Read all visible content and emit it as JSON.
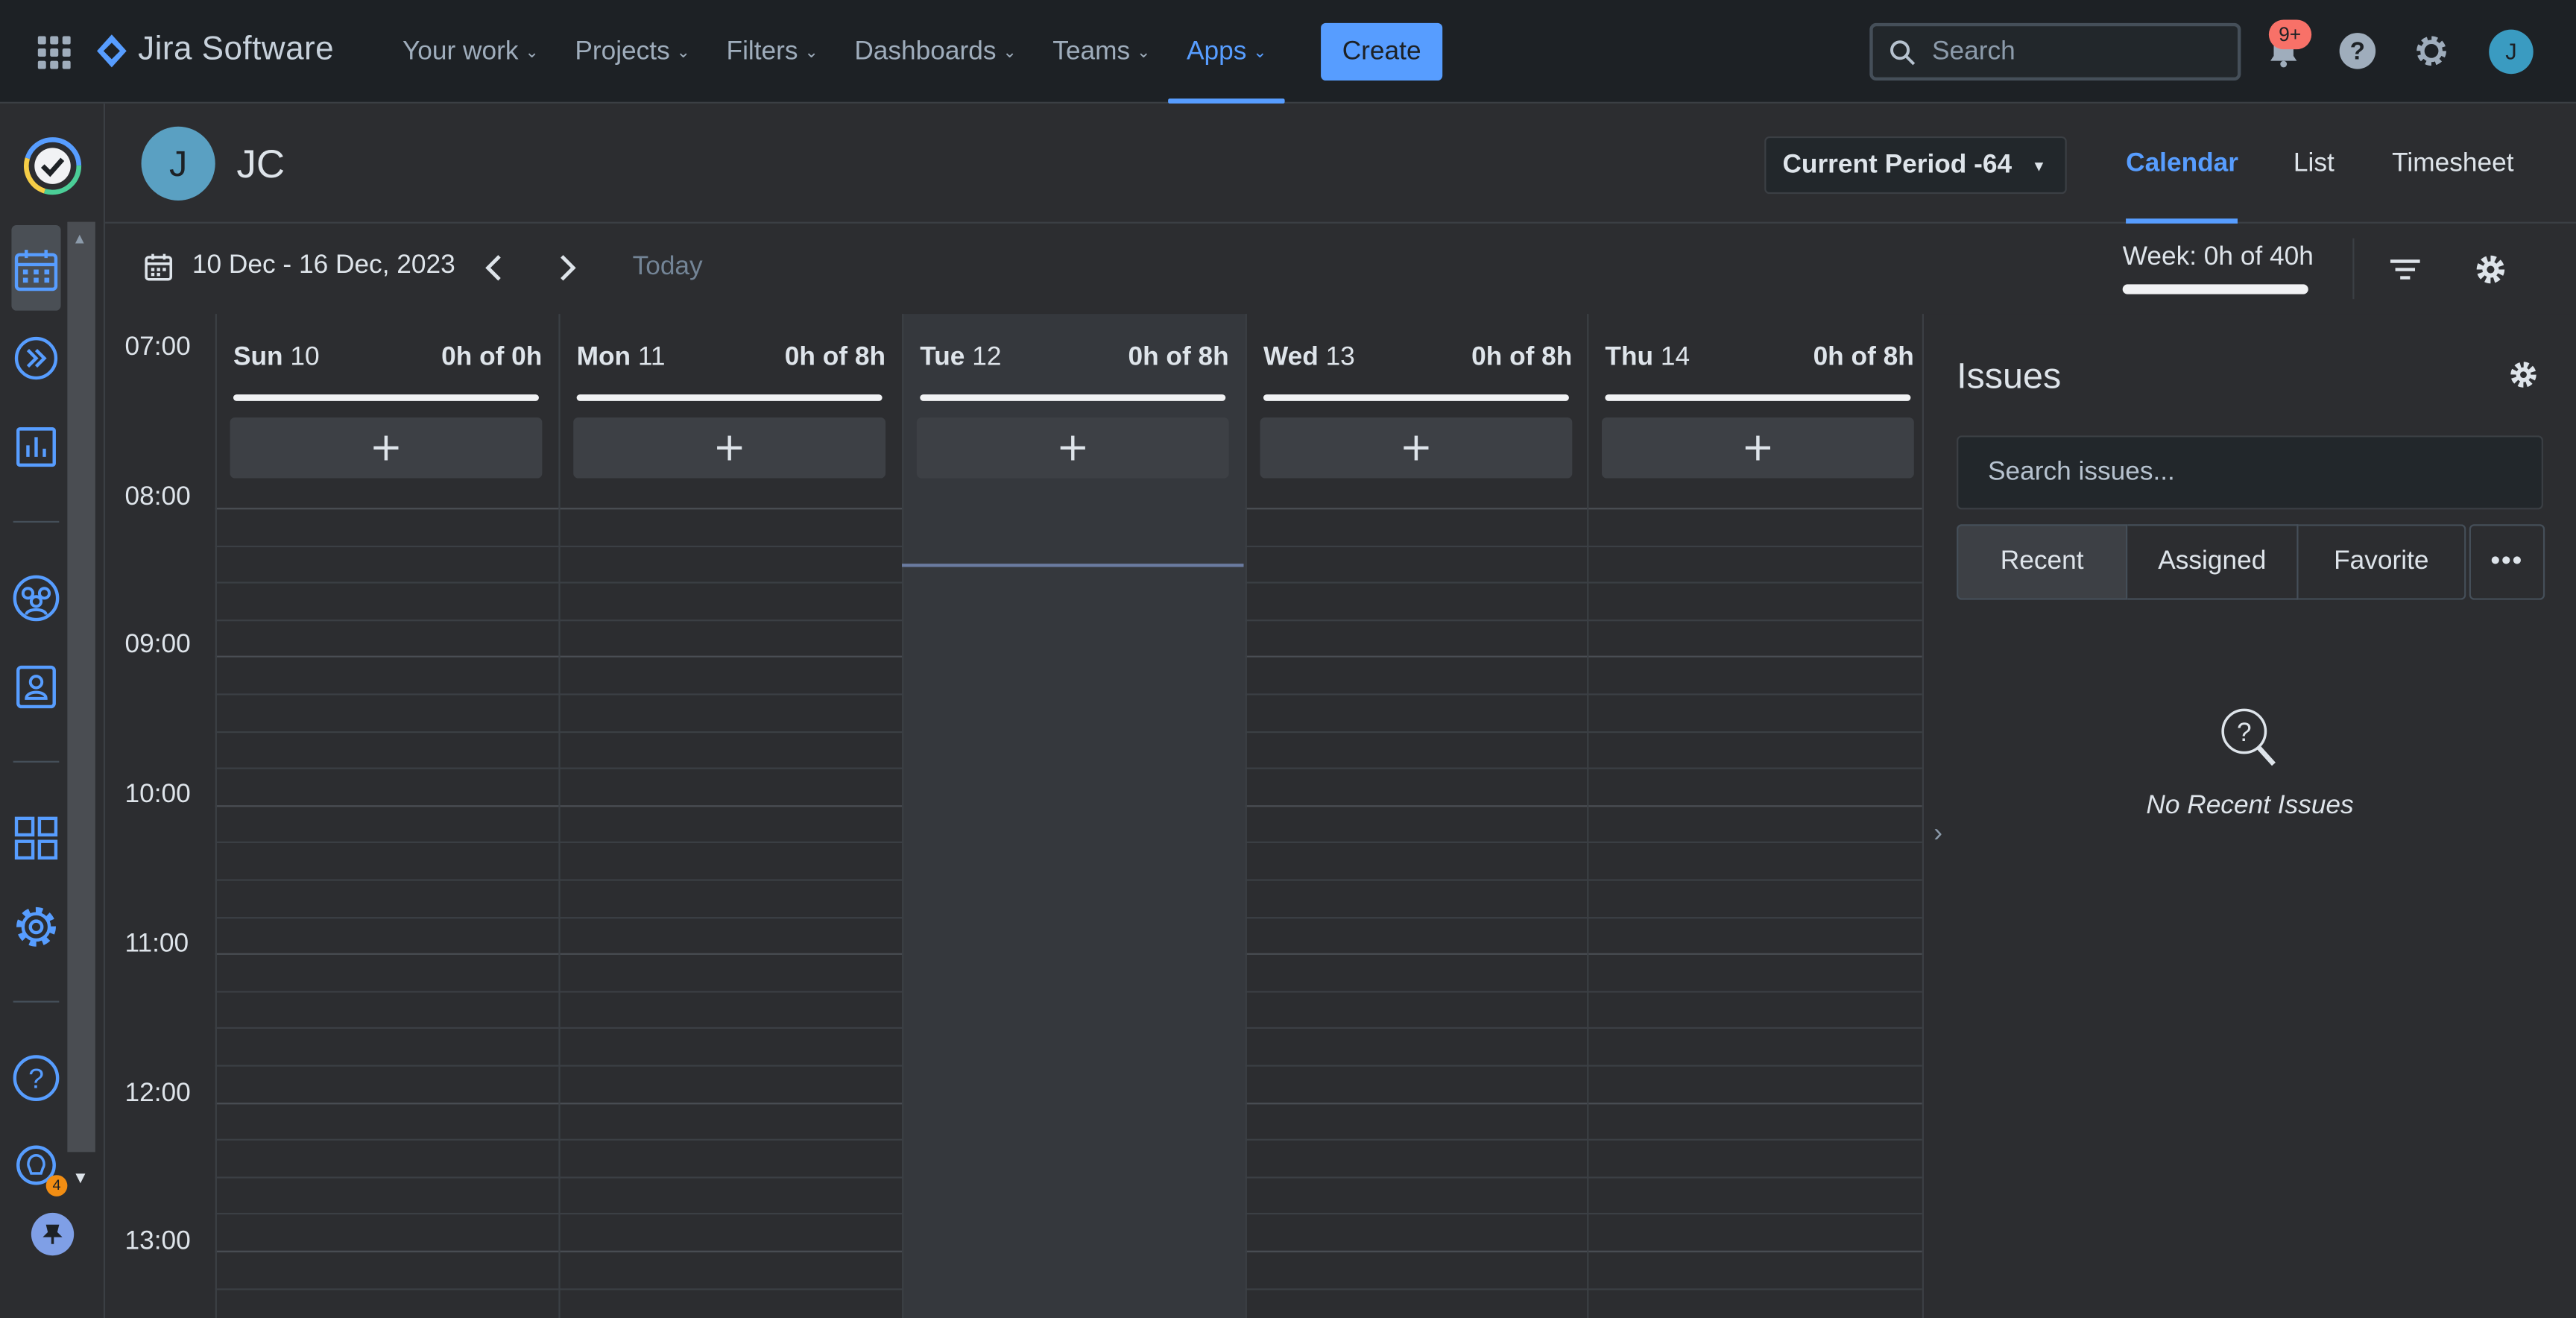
{
  "app": {
    "logo_text": "Jira Software",
    "accent": "#579dff"
  },
  "nav": {
    "items": [
      {
        "label": "Your work",
        "active": false
      },
      {
        "label": "Projects",
        "active": false
      },
      {
        "label": "Filters",
        "active": false
      },
      {
        "label": "Dashboards",
        "active": false
      },
      {
        "label": "Teams",
        "active": false
      },
      {
        "label": "Apps",
        "active": true
      }
    ],
    "create_label": "Create",
    "search_placeholder": "Search",
    "notifications_badge": "9+",
    "avatar_initial": "J"
  },
  "sidebar": {
    "icons": [
      "timesheet-app-logo-icon",
      "calendar-icon",
      "forward-icon",
      "report-chart-icon",
      "team-icon",
      "user-card-icon",
      "grid-apps-icon",
      "settings-gear-icon",
      "help-icon",
      "lightbulb-icon",
      "pin-icon"
    ],
    "lightbulb_badge": "4"
  },
  "header": {
    "avatar_initial": "J",
    "user_name": "JC",
    "period_label": "Current Period -64",
    "views": [
      {
        "label": "Calendar",
        "active": true
      },
      {
        "label": "List",
        "active": false
      },
      {
        "label": "Timesheet",
        "active": false
      }
    ]
  },
  "toolbar": {
    "date_range": "10 Dec - 16 Dec, 2023",
    "today_label": "Today",
    "week_summary": "Week: 0h of 40h"
  },
  "calendar": {
    "days": [
      {
        "day": "Sun",
        "date": "10",
        "hours": "0h of 0h",
        "today": false
      },
      {
        "day": "Mon",
        "date": "11",
        "hours": "0h of 8h",
        "today": false
      },
      {
        "day": "Tue",
        "date": "12",
        "hours": "0h of 8h",
        "today": true
      },
      {
        "day": "Wed",
        "date": "13",
        "hours": "0h of 8h",
        "today": false
      },
      {
        "day": "Thu",
        "date": "14",
        "hours": "0h of 8h",
        "today": false
      }
    ],
    "add_label": "+",
    "times": [
      "07:00",
      "08:00",
      "09:00",
      "10:00",
      "11:00",
      "12:00",
      "13:00"
    ]
  },
  "issues": {
    "title": "Issues",
    "search_placeholder": "Search issues...",
    "tabs": [
      {
        "label": "Recent",
        "active": true
      },
      {
        "label": "Assigned",
        "active": false
      },
      {
        "label": "Favorite",
        "active": false
      }
    ],
    "more_label": "•••",
    "empty_text": "No Recent Issues"
  }
}
